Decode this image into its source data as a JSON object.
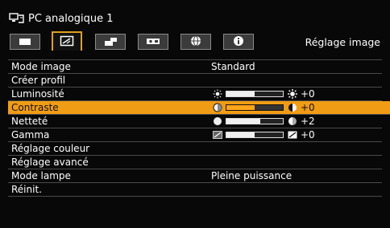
{
  "header": {
    "title": "PC analogique 1",
    "title_icon": "pc-input-icon"
  },
  "tabs": [
    {
      "icon": "display-tab-icon",
      "active": false
    },
    {
      "icon": "image-adjust-tab-icon",
      "active": true
    },
    {
      "icon": "install-settings-tab-icon",
      "active": false
    },
    {
      "icon": "system-settings-tab-icon",
      "active": false
    },
    {
      "icon": "network-tab-icon",
      "active": false
    },
    {
      "icon": "info-tab-icon",
      "active": false
    }
  ],
  "section_title": "Réglage image",
  "menu": [
    {
      "label": "Mode image",
      "value": "Standard"
    },
    {
      "label": "Créer profil"
    },
    {
      "label": "Luminosité",
      "slider": {
        "value": "+0",
        "level": 0.5,
        "left_icon": "sun-low-icon",
        "right_icon": "sun-high-icon"
      }
    },
    {
      "label": "Contraste",
      "selected": true,
      "slider": {
        "value": "+0",
        "level": 0.5,
        "left_icon": "contrast-low-icon",
        "right_icon": "contrast-high-icon"
      }
    },
    {
      "label": "Netteté",
      "slider": {
        "value": "+2",
        "level": 0.6,
        "left_icon": "sharpness-low-icon",
        "right_icon": "sharpness-high-icon"
      }
    },
    {
      "label": "Gamma",
      "slider": {
        "value": "+0",
        "level": 0.5,
        "left_icon": "gamma-low-icon",
        "right_icon": "gamma-high-icon"
      }
    },
    {
      "label": "Réglage couleur"
    },
    {
      "label": "Réglage avancé"
    },
    {
      "label": "Mode lampe",
      "value": "Pleine puissance"
    },
    {
      "label": "Réinit."
    }
  ],
  "colors": {
    "background": "#080808",
    "highlight": "#f09c14",
    "tab_active_border": "#e0a020"
  }
}
